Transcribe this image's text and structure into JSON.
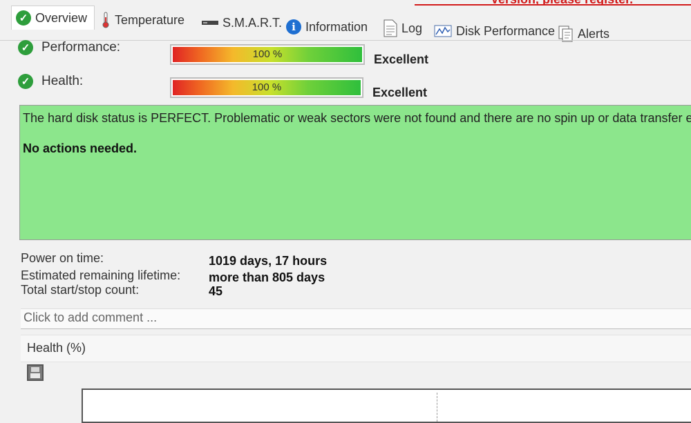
{
  "banner": {
    "text": "Version, please register."
  },
  "tabs": [
    {
      "label": "Overview",
      "icon": "check-icon",
      "active": true
    },
    {
      "label": "Temperature",
      "icon": "thermometer-icon"
    },
    {
      "label": "S.M.A.R.T.",
      "icon": "drive-icon"
    },
    {
      "label": "Information",
      "icon": "info-icon"
    },
    {
      "label": "Log",
      "icon": "document-icon"
    },
    {
      "label": "Disk Performance",
      "icon": "chart-icon"
    },
    {
      "label": "Alerts",
      "icon": "alerts-icon"
    }
  ],
  "performance": {
    "label": "Performance:",
    "value_text": "100 %",
    "value": 100,
    "rating": "Excellent"
  },
  "health": {
    "label": "Health:",
    "value_text": "100 %",
    "value": 100,
    "rating": "Excellent"
  },
  "status": {
    "message": "The hard disk status is PERFECT. Problematic or weak sectors were not found and there are no spin up or data transfer errors",
    "action": "No actions needed.",
    "background": "#8ce68c"
  },
  "stats": [
    {
      "label": "Power on time:",
      "value": "1019 days, 17 hours"
    },
    {
      "label": "Estimated remaining lifetime:",
      "value": "more than 805 days"
    },
    {
      "label": "Total start/stop count:",
      "value": "45"
    }
  ],
  "comment": {
    "placeholder": "Click to add comment ..."
  },
  "health_chart": {
    "title": "Health (%)"
  },
  "colors": {
    "ok_green": "#2e9e3c",
    "info_blue": "#1f6fd1",
    "alert_red": "#d21b1b"
  }
}
